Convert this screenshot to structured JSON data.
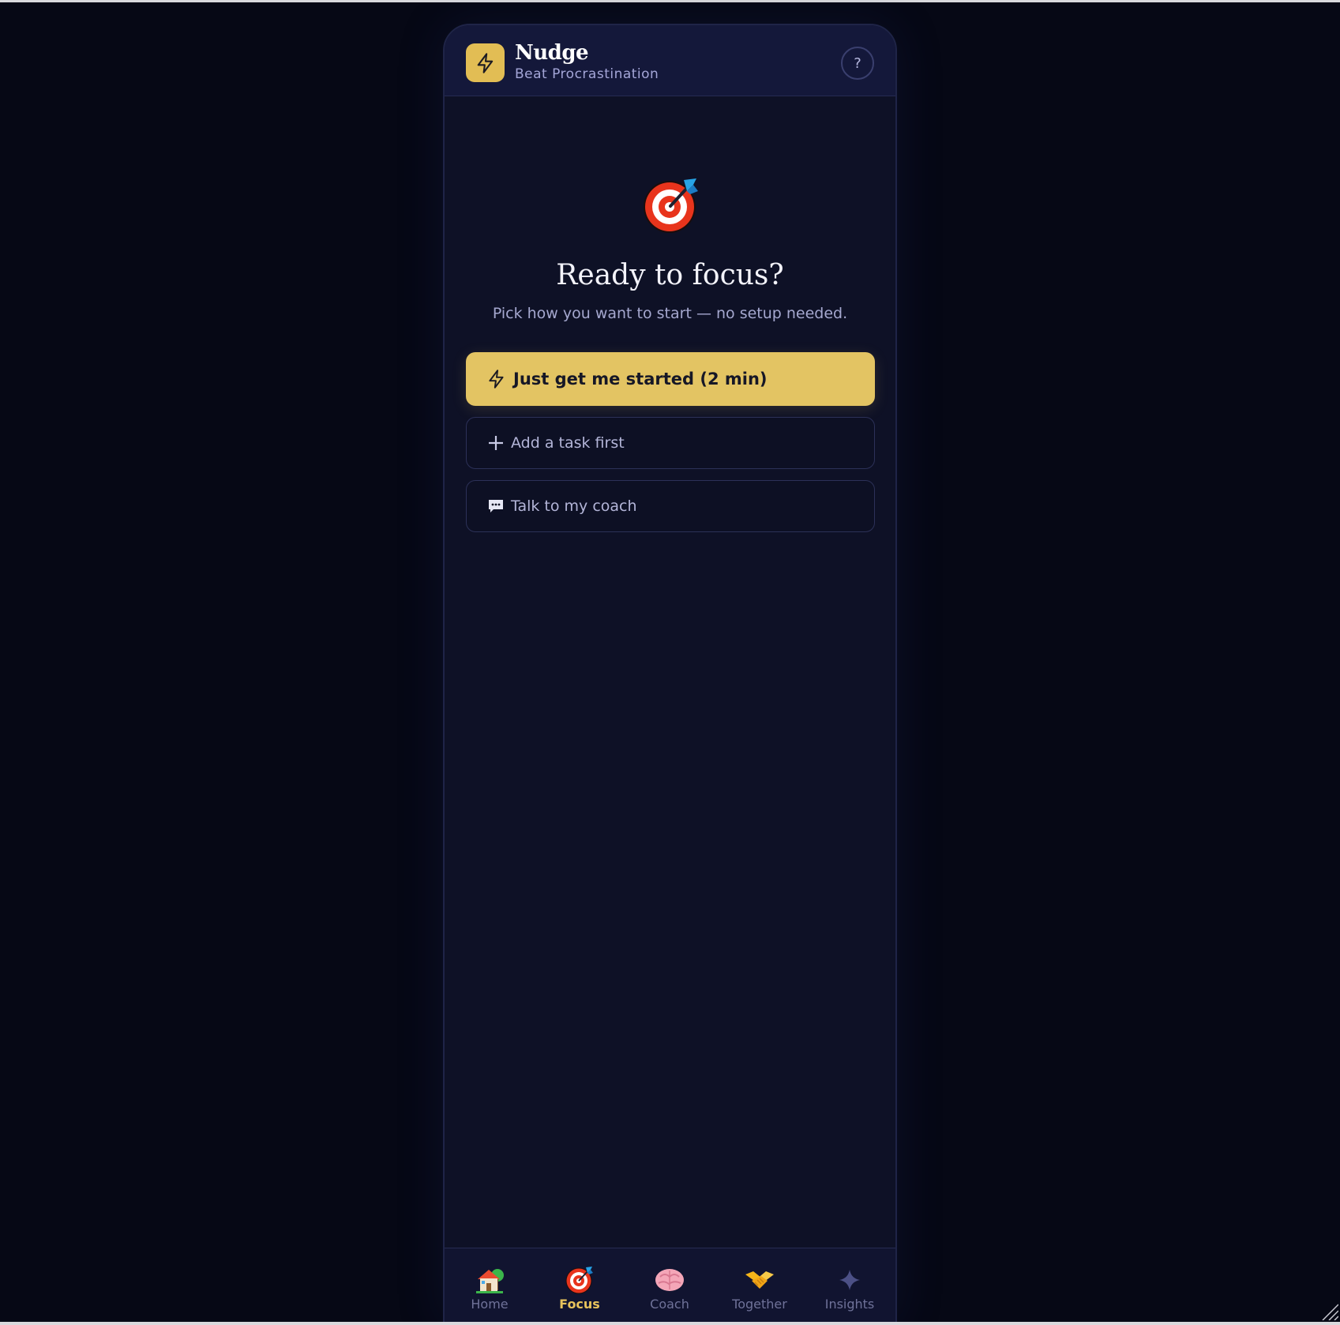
{
  "app": {
    "name": "Nudge",
    "tagline": "Beat Procrastination",
    "help_label": "?"
  },
  "hero": {
    "icon": "target-icon",
    "title": "Ready to focus?",
    "subtitle": "Pick how you want to start — no setup needed."
  },
  "actions": {
    "primary_label": "Just get me started (2 min)",
    "add_task_label": "Add a task first",
    "coach_label": "Talk to my coach"
  },
  "nav": {
    "active": "Focus",
    "items": [
      {
        "label": "Home",
        "icon": "house-icon"
      },
      {
        "label": "Focus",
        "icon": "target-icon"
      },
      {
        "label": "Coach",
        "icon": "brain-icon"
      },
      {
        "label": "Together",
        "icon": "handshake-icon"
      },
      {
        "label": "Insights",
        "icon": "sparkle-icon"
      }
    ]
  },
  "colors": {
    "background": "#060815",
    "panel": "#0e1126",
    "accent": "#e3c463",
    "text_muted": "#a5a8cf"
  }
}
